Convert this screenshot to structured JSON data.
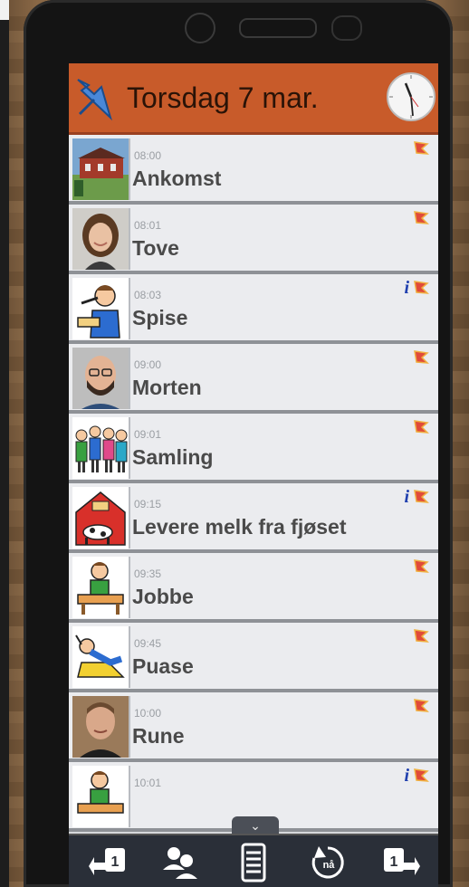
{
  "header": {
    "date": "Torsdag 7 mar."
  },
  "entries": [
    {
      "time": "08:00",
      "title": "Ankomst",
      "thumb": "building-photo",
      "info": false
    },
    {
      "time": "08:01",
      "title": "Tove",
      "thumb": "woman-photo",
      "info": false
    },
    {
      "time": "08:03",
      "title": "Spise",
      "thumb": "eating-pictogram",
      "info": true
    },
    {
      "time": "09:00",
      "title": "Morten",
      "thumb": "man-photo",
      "info": false
    },
    {
      "time": "09:01",
      "title": "Samling",
      "thumb": "group-pictogram",
      "info": false
    },
    {
      "time": "09:15",
      "title": "Levere melk fra fjøset",
      "thumb": "barn-pictogram",
      "info": true
    },
    {
      "time": "09:35",
      "title": "Jobbe",
      "thumb": "working-pictogram",
      "info": false
    },
    {
      "time": "09:45",
      "title": "Puase",
      "thumb": "resting-pictogram",
      "info": false
    },
    {
      "time": "10:00",
      "title": "Rune",
      "thumb": "man-photo",
      "info": false
    },
    {
      "time": "10:01",
      "title": "",
      "thumb": "working-pictogram",
      "info": true
    }
  ],
  "info_glyph": "i",
  "toolbar": {
    "scroll_glyph": "⌄",
    "prev_day_label": "1",
    "now_label": "nå",
    "next_day_label": "1"
  },
  "colors": {
    "header": "#c85b2a",
    "info": "#1f3fae",
    "flag": "#e04a3a"
  }
}
